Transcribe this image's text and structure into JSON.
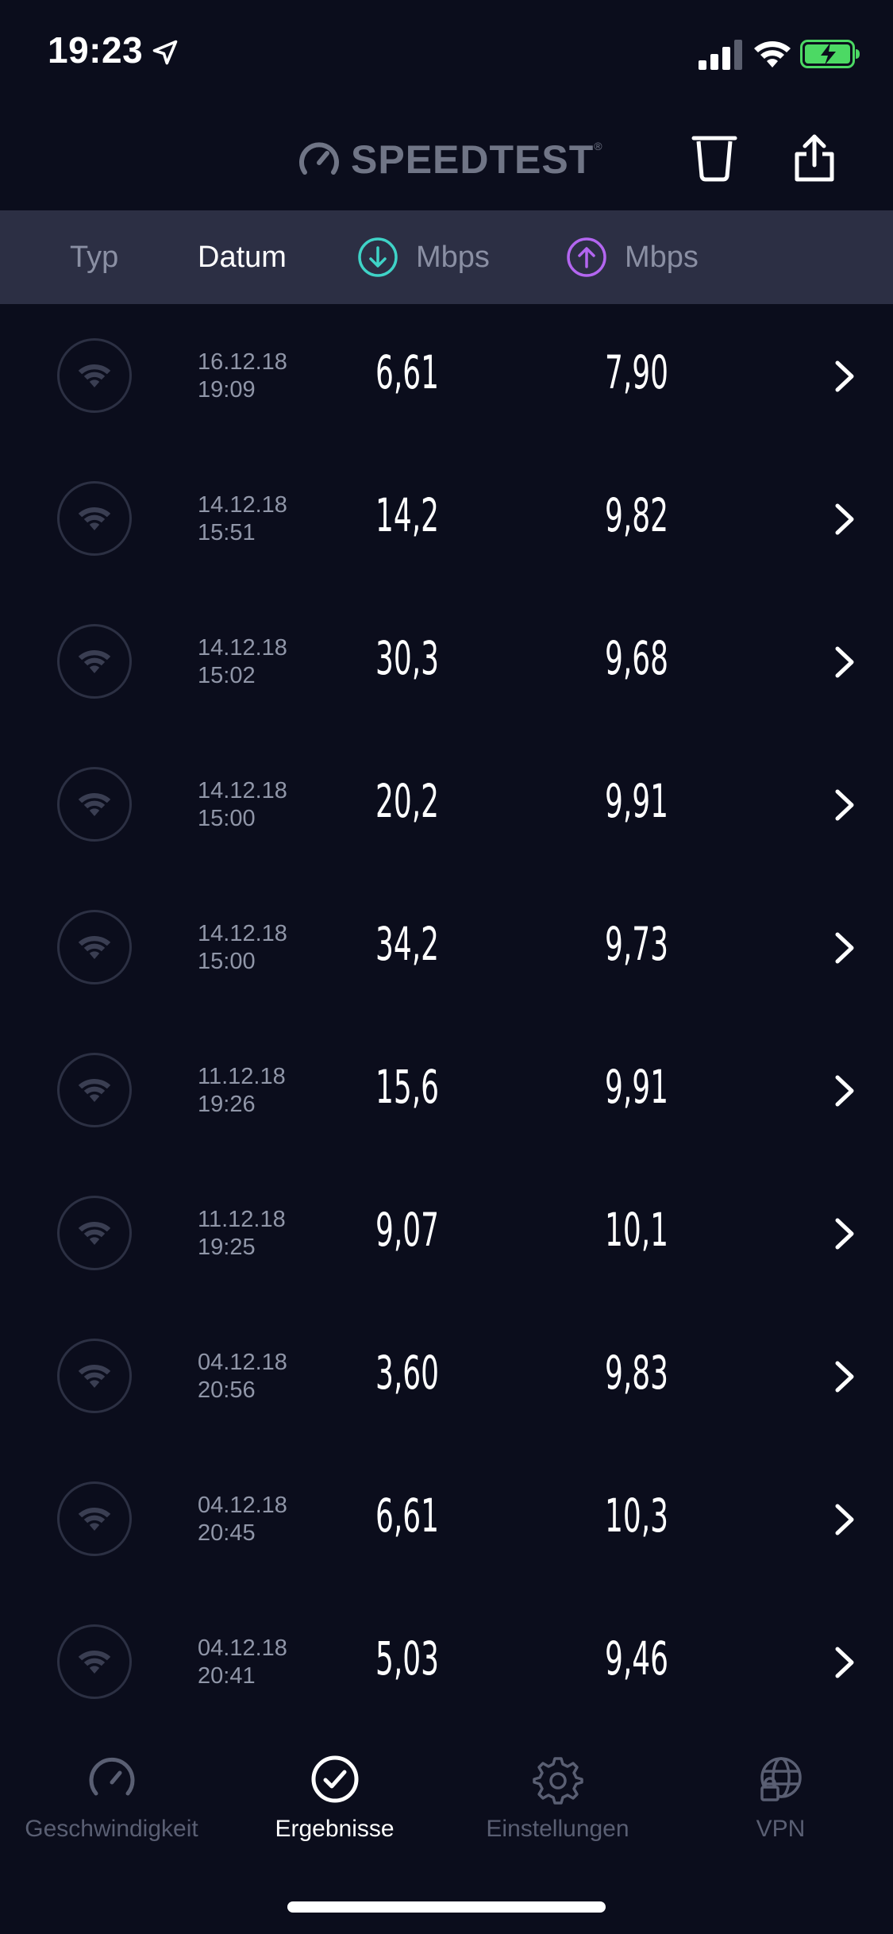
{
  "status_bar": {
    "time": "19:23",
    "icons": [
      "location-arrow-icon",
      "cellular-signal-icon",
      "wifi-icon",
      "battery-charging-icon"
    ]
  },
  "header": {
    "logo_text": "SPEEDTEST",
    "logo_tm": "®",
    "actions": [
      "trash-icon",
      "share-icon"
    ]
  },
  "columns": {
    "type_label": "Typ",
    "date_label": "Datum",
    "download_label": "Mbps",
    "upload_label": "Mbps"
  },
  "colors": {
    "background": "#0b0d1c",
    "column_bar": "#2c2f44",
    "download_accent": "#3fd3c7",
    "upload_accent": "#b366f0",
    "battery_green": "#4cd964"
  },
  "results": [
    {
      "date": "16.12.18",
      "time": "19:09",
      "download": "6,61",
      "upload": "7,90",
      "connection_icon": "wifi-icon"
    },
    {
      "date": "14.12.18",
      "time": "15:51",
      "download": "14,2",
      "upload": "9,82",
      "connection_icon": "wifi-icon"
    },
    {
      "date": "14.12.18",
      "time": "15:02",
      "download": "30,3",
      "upload": "9,68",
      "connection_icon": "wifi-icon"
    },
    {
      "date": "14.12.18",
      "time": "15:00",
      "download": "20,2",
      "upload": "9,91",
      "connection_icon": "wifi-icon"
    },
    {
      "date": "14.12.18",
      "time": "15:00",
      "download": "34,2",
      "upload": "9,73",
      "connection_icon": "wifi-icon"
    },
    {
      "date": "11.12.18",
      "time": "19:26",
      "download": "15,6",
      "upload": "9,91",
      "connection_icon": "wifi-icon"
    },
    {
      "date": "11.12.18",
      "time": "19:25",
      "download": "9,07",
      "upload": "10,1",
      "connection_icon": "wifi-icon"
    },
    {
      "date": "04.12.18",
      "time": "20:56",
      "download": "3,60",
      "upload": "9,83",
      "connection_icon": "wifi-icon"
    },
    {
      "date": "04.12.18",
      "time": "20:45",
      "download": "6,61",
      "upload": "10,3",
      "connection_icon": "wifi-icon"
    },
    {
      "date": "04.12.18",
      "time": "20:41",
      "download": "5,03",
      "upload": "9,46",
      "connection_icon": "wifi-icon"
    }
  ],
  "tabs": [
    {
      "label": "Geschwindigkeit",
      "icon": "speedometer-icon",
      "active": false
    },
    {
      "label": "Ergebnisse",
      "icon": "checkmark-circle-icon",
      "active": true
    },
    {
      "label": "Einstellungen",
      "icon": "gear-icon",
      "active": false
    },
    {
      "label": "VPN",
      "icon": "globe-lock-icon",
      "active": false
    }
  ]
}
